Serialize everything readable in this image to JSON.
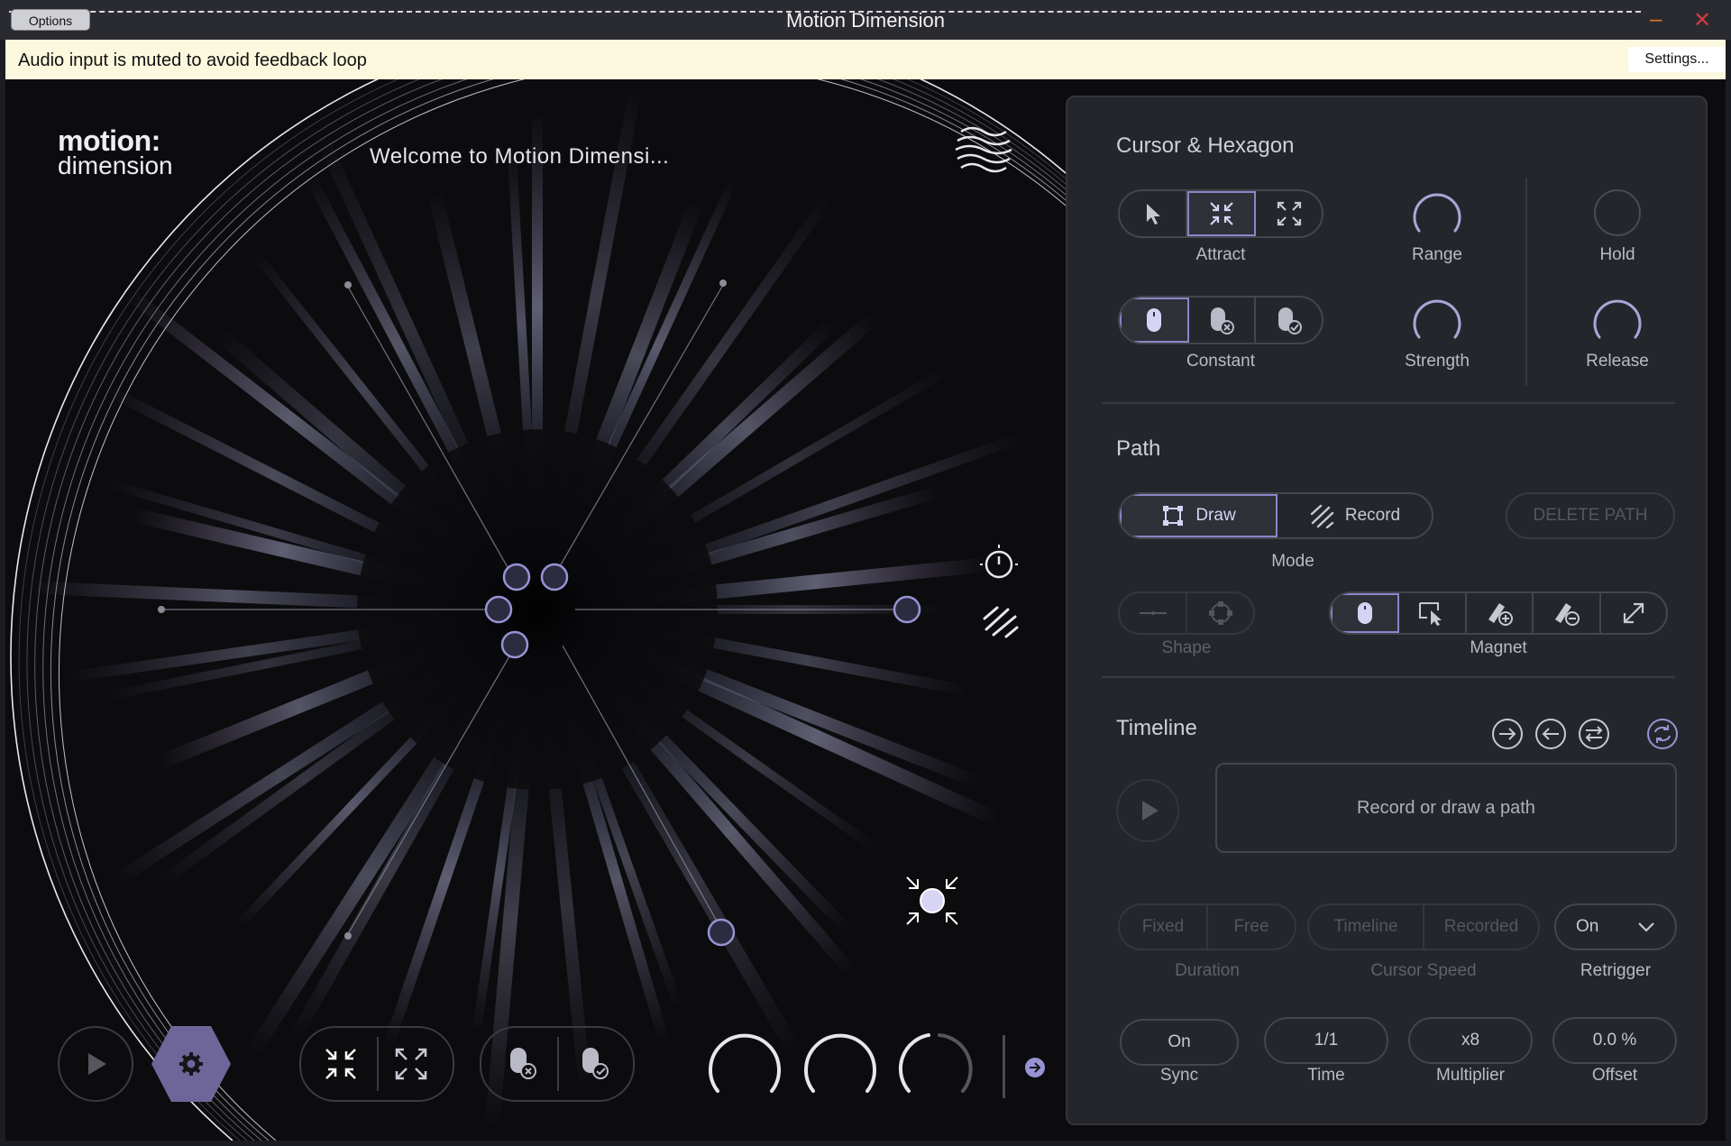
{
  "window": {
    "options_label": "Options",
    "title": "Motion Dimension",
    "minimize": "–",
    "close": "✕"
  },
  "warning": {
    "message": "Audio input is muted to avoid feedback loop",
    "settings_label": "Settings..."
  },
  "stage": {
    "logo_line1": "motion:",
    "logo_line2": "dimension",
    "welcome": "Welcome to Motion Dimensi..."
  },
  "panel": {
    "cursor_hexagon": {
      "title": "Cursor & Hexagon",
      "cursor_mode_label": "Attract",
      "cursor_modes": [
        "pointer-icon",
        "attract-icon",
        "repel-icon"
      ],
      "active_cursor_mode": 1,
      "hexagon_mode_label": "Constant",
      "hexagon_modes": [
        "mouse-icon",
        "mouse-x-icon",
        "mouse-check-icon"
      ],
      "active_hexagon_mode": 0,
      "range_label": "Range",
      "strength_label": "Strength",
      "hold_label": "Hold",
      "release_label": "Release"
    },
    "path": {
      "title": "Path",
      "draw_label": "Draw",
      "record_label": "Record",
      "delete_label": "DELETE PATH",
      "mode_label": "Mode",
      "shape_label": "Shape",
      "magnet_label": "Magnet"
    },
    "timeline": {
      "title": "Timeline",
      "placeholder": "Record or draw a path",
      "duration_options": [
        "Fixed",
        "Free"
      ],
      "duration_label": "Duration",
      "cursor_speed_options": [
        "Timeline",
        "Recorded"
      ],
      "cursor_speed_label": "Cursor Speed",
      "retrigger_value": "On",
      "retrigger_label": "Retrigger",
      "sync_value": "On",
      "sync_label": "Sync",
      "time_value": "1/1",
      "time_label": "Time",
      "multiplier_value": "x8",
      "multiplier_label": "Multiplier",
      "offset_value": "0.0 %",
      "offset_label": "Offset"
    }
  },
  "colors": {
    "accent": "#8b85c8",
    "hex_button": "#6e6699",
    "background": "#0c0c0f",
    "panel": "#25262c"
  }
}
